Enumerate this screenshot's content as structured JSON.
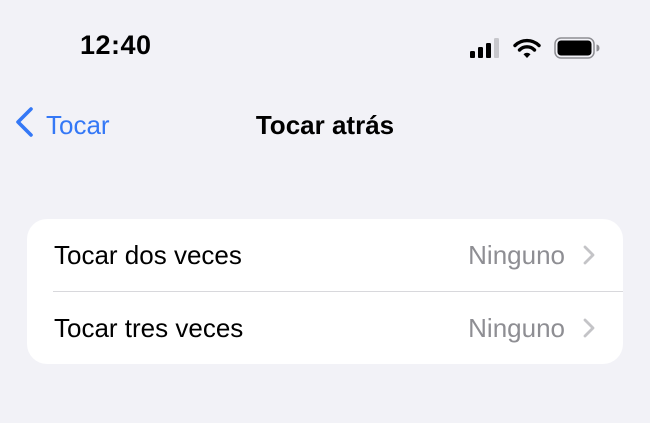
{
  "status_bar": {
    "time": "12:40",
    "icons": [
      "cellular-signal-icon",
      "wifi-icon",
      "battery-icon"
    ]
  },
  "nav": {
    "back_label": "Tocar",
    "title": "Tocar atrás"
  },
  "settings": {
    "rows": [
      {
        "label": "Tocar dos veces",
        "value": "Ninguno"
      },
      {
        "label": "Tocar tres veces",
        "value": "Ninguno"
      }
    ]
  },
  "colors": {
    "background": "#f2f2f7",
    "accent": "#3478f6",
    "secondary_text": "#8e8e93",
    "chevron": "#c4c4c7"
  }
}
